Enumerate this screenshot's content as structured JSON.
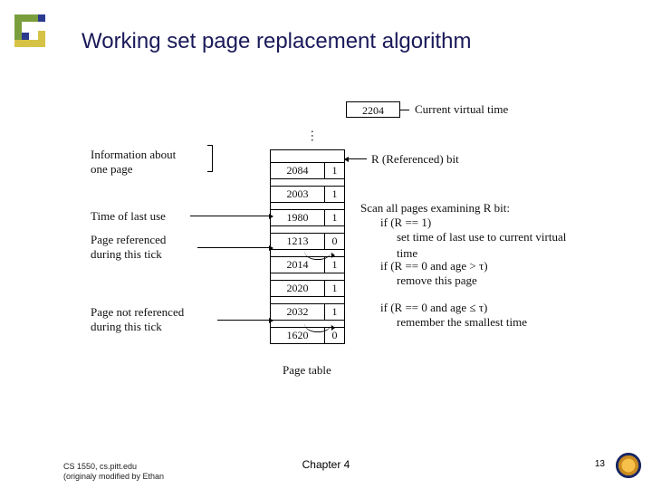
{
  "title": "Working set page replacement algorithm",
  "current_virtual_time": {
    "value": "2204",
    "label": "Current virtual time"
  },
  "r_bit_label": "R (Referenced) bit",
  "left_labels": {
    "info": "Information about\none page",
    "time_of_last_use": "Time of last use",
    "referenced": "Page referenced\nduring this tick",
    "not_referenced": "Page not referenced\nduring this tick"
  },
  "algorithm_text": {
    "scan": "Scan all pages examining R bit:",
    "if_r1_a": "if (R == 1)",
    "if_r1_b": "set time of last use to current virtual time",
    "if_r0a_a": "if (R == 0 and age > τ)",
    "if_r0a_b": "remove this page",
    "if_r0b_a": "if (R == 0 and age ≤ τ)",
    "if_r0b_b": "remember the smallest time"
  },
  "page_table_caption": "Page table",
  "page_table_rows": [
    {
      "time": "2084",
      "r": "1"
    },
    {
      "time": "2003",
      "r": "1"
    },
    {
      "time": "1980",
      "r": "1"
    },
    {
      "time": "1213",
      "r": "0"
    },
    {
      "time": "2014",
      "r": "1"
    },
    {
      "time": "2020",
      "r": "1"
    },
    {
      "time": "2032",
      "r": "1"
    },
    {
      "time": "1620",
      "r": "0"
    }
  ],
  "footer": {
    "left_line1": "CS 1550, cs.pitt.edu",
    "left_line2": "(originaly modified by Ethan",
    "center": "Chapter 4",
    "page_number": "13"
  }
}
